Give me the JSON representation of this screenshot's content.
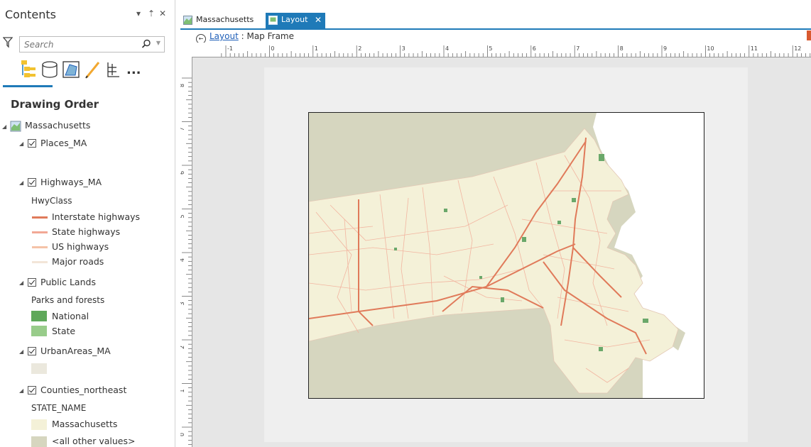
{
  "contents": {
    "title": "Contents",
    "controls": {
      "dropdown": "▾",
      "pin": "⇡",
      "close": "✕"
    },
    "search": {
      "placeholder": "Search"
    },
    "views": [
      "list-by-drawing-order-icon",
      "list-by-source-icon",
      "list-by-selection-icon",
      "list-by-editing-icon",
      "list-by-snapping-icon",
      "more-options"
    ],
    "more_label": "...",
    "section_title": "Drawing Order",
    "map_name": "Massachusetts",
    "layers": [
      {
        "name": "Places_MA",
        "checked": true
      },
      {
        "name": "Highways_MA",
        "checked": true,
        "group": "HwyClass",
        "legend": [
          {
            "label": "Interstate highways",
            "color": "#e07a5a"
          },
          {
            "label": "State highways",
            "color": "#f2a895"
          },
          {
            "label": "US highways",
            "color": "#f5c3a8"
          },
          {
            "label": "Major roads",
            "color": "#f3e5d8"
          }
        ]
      },
      {
        "name": "Public Lands",
        "checked": true,
        "group": "Parks and forests",
        "legend": [
          {
            "label": "National",
            "color": "#5fa85a"
          },
          {
            "label": "State",
            "color": "#98cc8a"
          }
        ]
      },
      {
        "name": "UrbanAreas_MA",
        "checked": true,
        "swatch": "#ebe8dd"
      },
      {
        "name": "Counties_northeast",
        "checked": true,
        "group": "STATE_NAME",
        "legend": [
          {
            "label": "Massachusetts",
            "color": "#f4f1d8"
          },
          {
            "label": "<all other values>",
            "color": "#d6d6bf"
          }
        ]
      }
    ]
  },
  "tabs": [
    {
      "label": "Massachusetts",
      "active": false
    },
    {
      "label": "Layout",
      "active": true,
      "close": "✕"
    }
  ],
  "breadcrumb": {
    "link": "Layout",
    "rest": " : Map Frame"
  },
  "ruler": {
    "top": [
      "-1",
      "0",
      "1",
      "2",
      "3",
      "4",
      "5",
      "6",
      "7",
      "8",
      "9",
      "10",
      "11",
      "12"
    ],
    "left": [
      "8",
      "7",
      "6",
      "5",
      "4",
      "3",
      "2",
      "1",
      "0"
    ]
  },
  "colors": {
    "accent": "#1f7ab8",
    "other_states": "#d6d6bf",
    "massachusetts": "#f4f1d8",
    "interstate": "#e07a5a",
    "road": "#f2b5a0",
    "forest": "#6aa86a",
    "water": "#ffffff"
  }
}
